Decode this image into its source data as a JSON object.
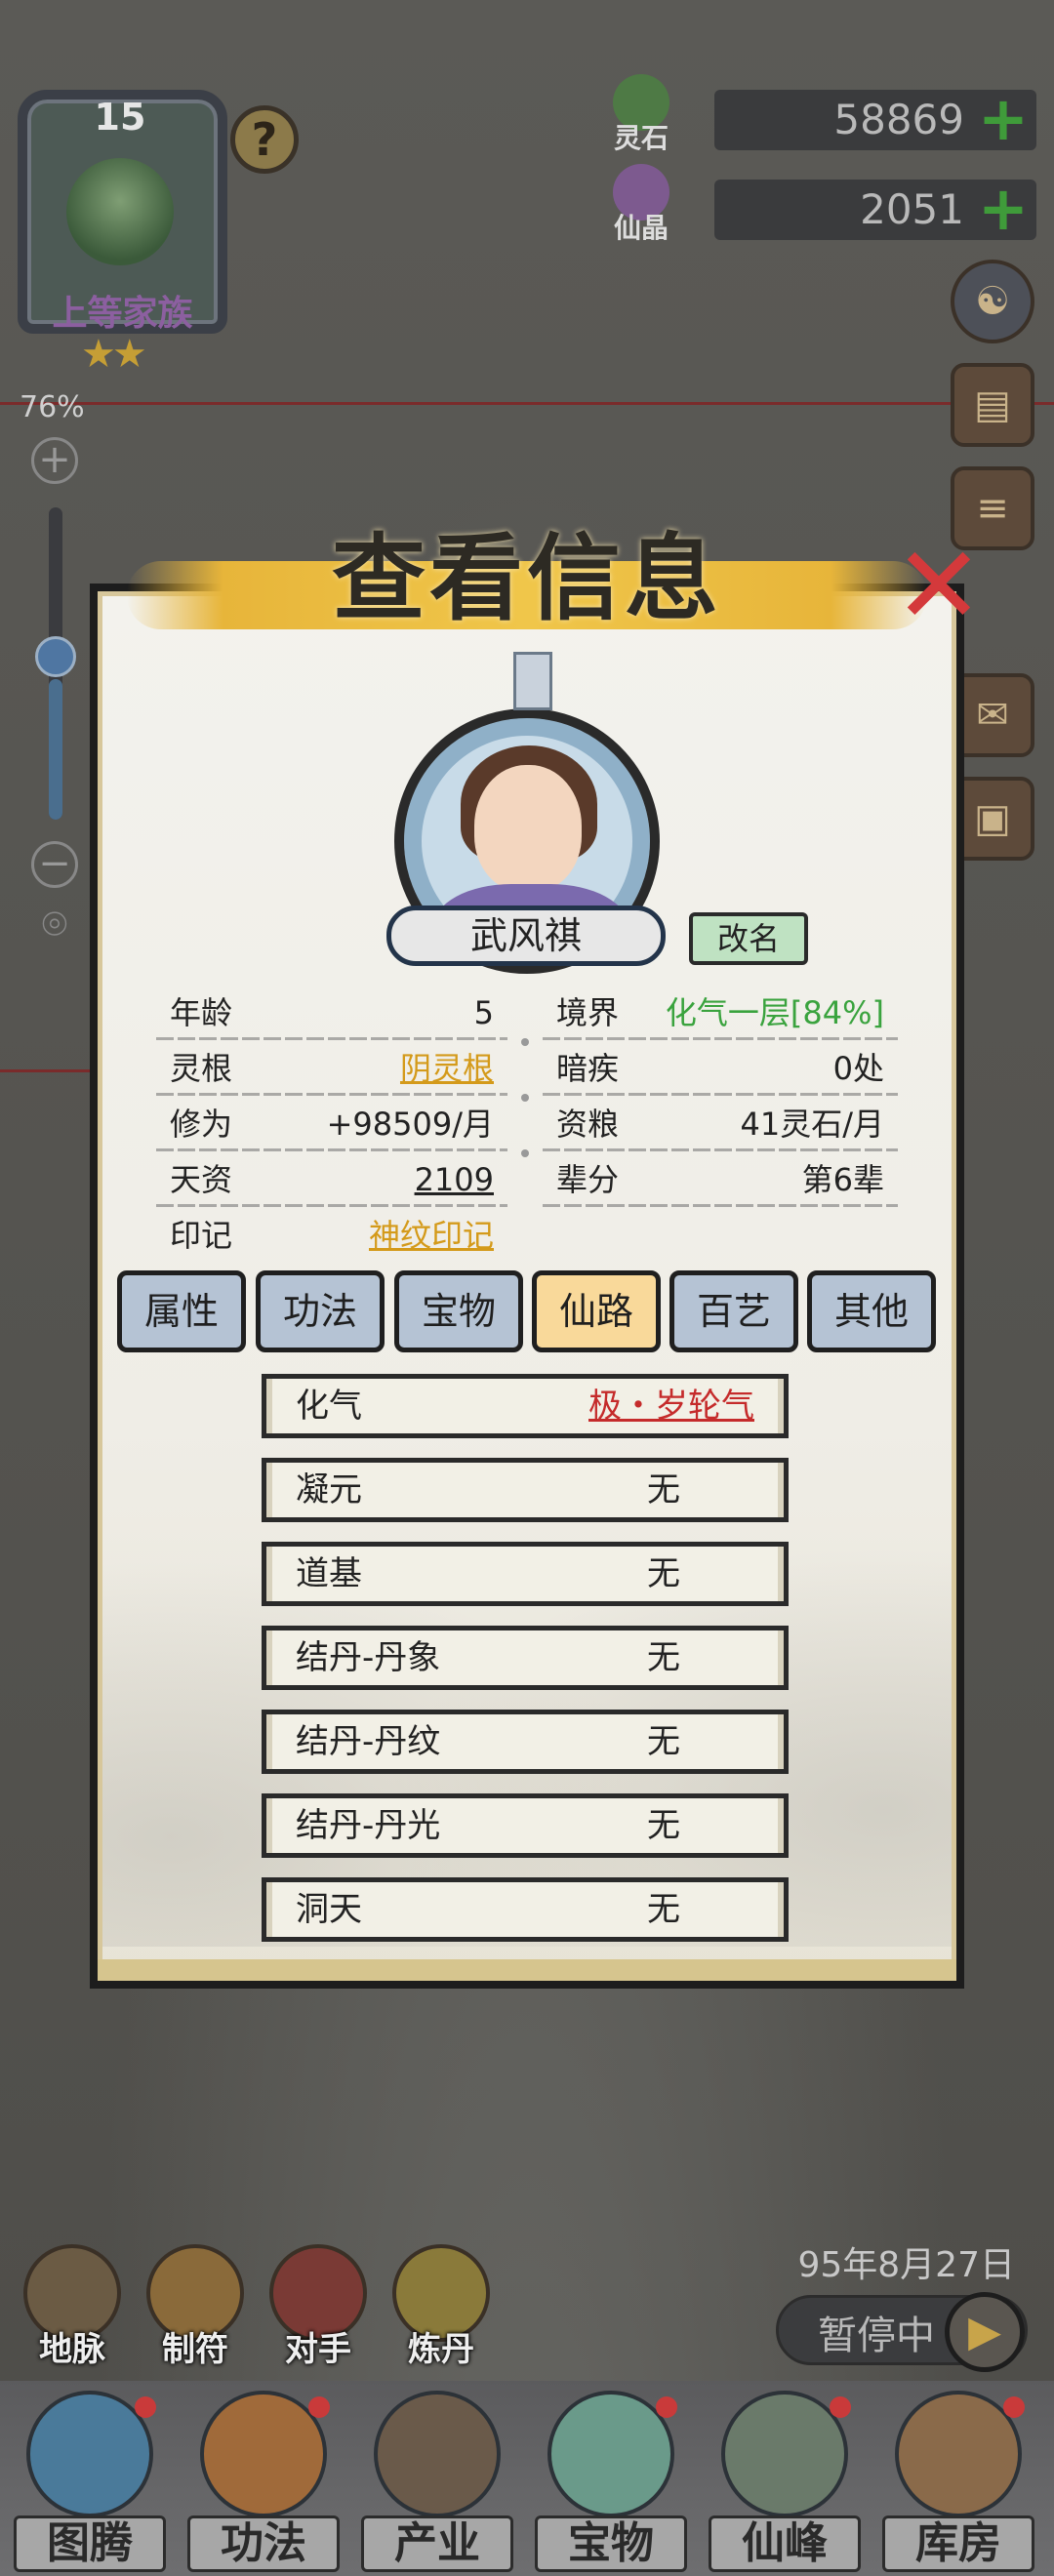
{
  "family": {
    "level": "15",
    "name": "上等家族",
    "stars": "★★"
  },
  "help": "?",
  "zoom": {
    "percent": "76%",
    "plus": "+",
    "minus": "−",
    "level": 0.45
  },
  "currencies": [
    {
      "label": "灵石",
      "value": "58869",
      "plus": "+",
      "color": "#4e7a45"
    },
    {
      "label": "仙晶",
      "value": "2051",
      "plus": "+",
      "color": "#7d5a8f"
    }
  ],
  "dialog": {
    "title": "查看信息",
    "close": "✕",
    "name": "武风祺",
    "rename": "改名",
    "info": {
      "age_label": "年龄",
      "age": "5",
      "realm_label": "境界",
      "realm": "化气一层[84%]",
      "root_label": "灵根",
      "root": "阴灵根",
      "illness_label": "暗疾",
      "illness": "0处",
      "cultivation_label": "修为",
      "cultivation": "+98509/月",
      "food_label": "资粮",
      "food": "41灵石/月",
      "talent_label": "天资",
      "talent": "2109",
      "generation_label": "辈分",
      "generation": "第6辈",
      "seal_label": "印记",
      "seal": "神纹印记"
    },
    "tabs": [
      "属性",
      "功法",
      "宝物",
      "仙路",
      "百艺",
      "其他"
    ],
    "active_tab": "仙路",
    "path": [
      {
        "stage": "化气",
        "value": "极・岁轮气"
      },
      {
        "stage": "凝元",
        "value": "无"
      },
      {
        "stage": "道基",
        "value": "无"
      },
      {
        "stage": "结丹-丹象",
        "value": "无"
      },
      {
        "stage": "结丹-丹纹",
        "value": "无"
      },
      {
        "stage": "结丹-丹光",
        "value": "无"
      },
      {
        "stage": "洞天",
        "value": "无"
      }
    ]
  },
  "date": "95年8月27日",
  "pause": {
    "label": "暂停中",
    "play": "▶"
  },
  "quick_actions": [
    "地脉",
    "制符",
    "对手",
    "炼丹"
  ],
  "nav": [
    "图腾",
    "功法",
    "产业",
    "宝物",
    "仙峰",
    "库房"
  ]
}
